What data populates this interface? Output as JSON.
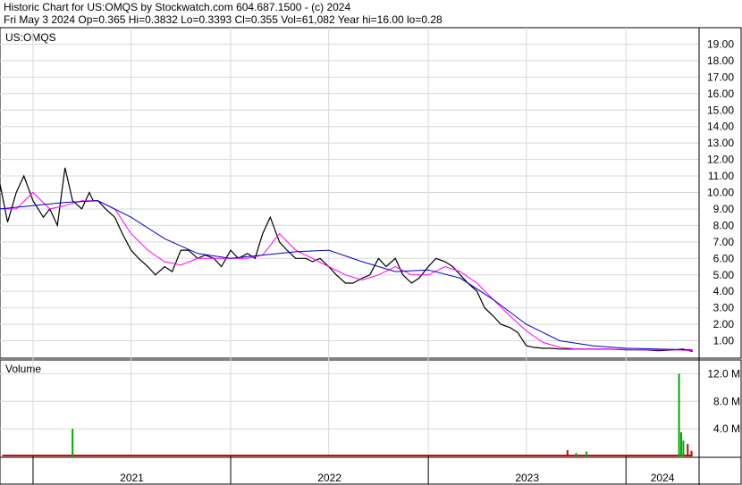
{
  "header": {
    "line1": "Historic Chart for US:OMQS by Stockwatch.com 604.687.1500 - (c) 2024",
    "line2": "Fri May  3 2024  Op=0.365  Hi=0.3832  Lo=0.3393  Cl=0.355  Vol=61,082  Year hi=16.00  lo=0.28"
  },
  "chart_data": {
    "type": "line",
    "panels": {
      "price": {
        "label": "US:OMQS",
        "ylim": [
          0,
          20
        ],
        "yticks": [
          "1.00",
          "2.00",
          "3.00",
          "4.00",
          "5.00",
          "6.00",
          "7.00",
          "8.00",
          "9.00",
          "10.00",
          "11.00",
          "12.00",
          "13.00",
          "14.00",
          "15.00",
          "16.00",
          "17.00",
          "18.00",
          "19.00"
        ]
      },
      "volume": {
        "label": "Volume",
        "ylim": [
          0,
          14
        ],
        "yticks": [
          "4.0 M",
          "8.0 M",
          "12.0 M"
        ],
        "yticks_values": [
          4,
          8,
          12
        ]
      }
    },
    "x_axis": {
      "range": [
        "2020-11-01",
        "2024-05-15"
      ],
      "years": [
        "2021",
        "2022",
        "2023",
        "2024"
      ],
      "year_starts": [
        "2021-01-01",
        "2022-01-01",
        "2023-01-01",
        "2024-01-01"
      ],
      "gridlines": [
        "2021-07-01",
        "2022-07-01",
        "2023-07-01"
      ]
    },
    "series": [
      {
        "key": "price",
        "color": "#000000",
        "x": [
          "2020-11-01",
          "2020-11-15",
          "2020-12-01",
          "2020-12-15",
          "2021-01-01",
          "2021-01-20",
          "2021-02-01",
          "2021-02-15",
          "2021-03-01",
          "2021-03-15",
          "2021-04-01",
          "2021-04-15",
          "2021-04-22",
          "2021-05-01",
          "2021-05-15",
          "2021-06-01",
          "2021-06-15",
          "2021-07-01",
          "2021-07-15",
          "2021-08-01",
          "2021-08-15",
          "2021-09-01",
          "2021-09-15",
          "2021-10-01",
          "2021-10-15",
          "2021-11-01",
          "2021-11-15",
          "2021-12-01",
          "2021-12-15",
          "2022-01-01",
          "2022-01-15",
          "2022-02-01",
          "2022-02-15",
          "2022-03-01",
          "2022-03-15",
          "2022-04-01",
          "2022-04-15",
          "2022-05-01",
          "2022-05-10",
          "2022-05-20",
          "2022-06-01",
          "2022-06-15",
          "2022-07-01",
          "2022-07-15",
          "2022-08-01",
          "2022-08-15",
          "2022-09-01",
          "2022-09-15",
          "2022-10-01",
          "2022-10-15",
          "2022-11-01",
          "2022-11-15",
          "2022-12-01",
          "2022-12-15",
          "2023-01-01",
          "2023-01-15",
          "2023-02-01",
          "2023-02-15",
          "2023-03-01",
          "2023-03-15",
          "2023-04-01",
          "2023-04-15",
          "2023-05-01",
          "2023-05-15",
          "2023-06-01",
          "2023-06-15",
          "2023-07-01",
          "2023-07-15",
          "2023-08-01",
          "2023-08-15",
          "2023-09-01",
          "2023-10-01",
          "2023-11-01",
          "2023-12-01",
          "2024-01-01",
          "2024-02-01",
          "2024-03-01",
          "2024-04-01",
          "2024-04-15",
          "2024-05-03"
        ],
        "y": [
          10.5,
          8.2,
          10.0,
          11.0,
          9.5,
          8.5,
          9.0,
          8.0,
          11.5,
          9.5,
          9.0,
          10.0,
          9.5,
          9.5,
          9.0,
          8.5,
          7.5,
          6.5,
          6.0,
          5.5,
          5.0,
          5.5,
          5.2,
          6.5,
          6.5,
          6.0,
          6.2,
          6.0,
          5.5,
          6.5,
          6.0,
          6.3,
          6.0,
          7.5,
          8.5,
          7.0,
          6.5,
          6.0,
          6.0,
          6.0,
          5.8,
          6.0,
          5.5,
          5.0,
          4.5,
          4.5,
          4.8,
          5.0,
          6.0,
          5.5,
          6.0,
          5.0,
          4.5,
          4.8,
          5.5,
          6.0,
          5.8,
          5.5,
          5.0,
          4.5,
          4.0,
          3.0,
          2.5,
          2.0,
          1.8,
          1.5,
          0.7,
          0.6,
          0.55,
          0.55,
          0.5,
          0.5,
          0.5,
          0.5,
          0.45,
          0.45,
          0.4,
          0.45,
          0.5,
          0.355
        ]
      },
      {
        "key": "ma_short",
        "color": "#ff00ff",
        "x": [
          "2020-11-01",
          "2020-12-01",
          "2021-01-01",
          "2021-02-01",
          "2021-03-01",
          "2021-04-01",
          "2021-05-01",
          "2021-06-01",
          "2021-07-01",
          "2021-08-01",
          "2021-09-01",
          "2021-10-01",
          "2021-11-01",
          "2021-12-01",
          "2022-01-01",
          "2022-02-01",
          "2022-03-01",
          "2022-04-01",
          "2022-05-01",
          "2022-06-01",
          "2022-07-01",
          "2022-08-01",
          "2022-09-01",
          "2022-10-01",
          "2022-11-01",
          "2022-12-01",
          "2023-01-01",
          "2023-02-01",
          "2023-03-01",
          "2023-04-01",
          "2023-05-01",
          "2023-06-01",
          "2023-07-01",
          "2023-08-01",
          "2023-09-01",
          "2023-10-01",
          "2023-12-01",
          "2024-02-01",
          "2024-04-01",
          "2024-05-03"
        ],
        "y": [
          9.0,
          9.0,
          10.0,
          9.0,
          9.2,
          9.5,
          9.5,
          9.0,
          7.5,
          6.5,
          5.8,
          5.6,
          6.0,
          6.0,
          6.0,
          6.0,
          6.2,
          7.5,
          6.5,
          6.0,
          5.5,
          5.0,
          4.7,
          5.0,
          5.5,
          5.0,
          5.0,
          5.5,
          5.2,
          4.5,
          3.5,
          2.5,
          1.6,
          0.9,
          0.6,
          0.5,
          0.5,
          0.45,
          0.45,
          0.4
        ]
      },
      {
        "key": "ma_long",
        "color": "#0000cc",
        "x": [
          "2020-11-01",
          "2021-01-01",
          "2021-03-01",
          "2021-05-01",
          "2021-07-01",
          "2021-09-01",
          "2021-11-01",
          "2022-01-01",
          "2022-03-01",
          "2022-05-01",
          "2022-07-01",
          "2022-09-01",
          "2022-11-01",
          "2023-01-01",
          "2023-03-01",
          "2023-05-01",
          "2023-07-01",
          "2023-09-01",
          "2023-11-01",
          "2024-01-01",
          "2024-03-01",
          "2024-05-03"
        ],
        "y": [
          9.0,
          9.2,
          9.4,
          9.5,
          8.5,
          7.2,
          6.3,
          6.0,
          6.2,
          6.4,
          6.5,
          5.8,
          5.2,
          5.3,
          4.8,
          3.5,
          2.0,
          1.0,
          0.7,
          0.55,
          0.5,
          0.45
        ]
      }
    ],
    "volume_bars": {
      "red_color": "#cc0000",
      "green_color": "#00aa00",
      "spikes": [
        {
          "x": "2021-03-15",
          "v": 4.0,
          "color": "#00aa00"
        },
        {
          "x": "2023-09-15",
          "v": 0.9,
          "color": "#cc0000"
        },
        {
          "x": "2023-10-01",
          "v": 0.5,
          "color": "#00aa00"
        },
        {
          "x": "2023-10-20",
          "v": 0.7,
          "color": "#00aa00"
        },
        {
          "x": "2024-04-08",
          "v": 12.0,
          "color": "#00aa00"
        },
        {
          "x": "2024-04-12",
          "v": 3.5,
          "color": "#00aa00"
        },
        {
          "x": "2024-04-16",
          "v": 2.3,
          "color": "#00aa00"
        },
        {
          "x": "2024-04-24",
          "v": 1.8,
          "color": "#cc0000"
        },
        {
          "x": "2024-05-01",
          "v": 0.8,
          "color": "#cc0000"
        }
      ]
    }
  }
}
